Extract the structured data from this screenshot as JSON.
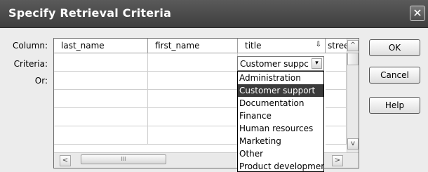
{
  "window": {
    "title": "Specify Retrieval Criteria",
    "close_glyph": "✕"
  },
  "row_labels": {
    "column": "Column:",
    "criteria": "Criteria:",
    "or": "Or:"
  },
  "grid": {
    "headers": [
      "last_name",
      "first_name",
      "title",
      "stree"
    ],
    "sort_glyph": "⇩"
  },
  "title_combo": {
    "value": "Customer suppc",
    "arrow_glyph": "▾"
  },
  "dropdown": {
    "options": [
      "Administration",
      "Customer support",
      "Documentation",
      "Finance",
      "Human resources",
      "Marketing",
      "Other",
      "Product developmen"
    ],
    "selected_index": 1
  },
  "scrollbars": {
    "left_glyph": "<",
    "right_glyph": ">",
    "up_glyph": "^",
    "down_glyph": "v",
    "thumb_grip": "III"
  },
  "buttons": {
    "ok": "OK",
    "cancel": "Cancel",
    "help": "Help"
  }
}
